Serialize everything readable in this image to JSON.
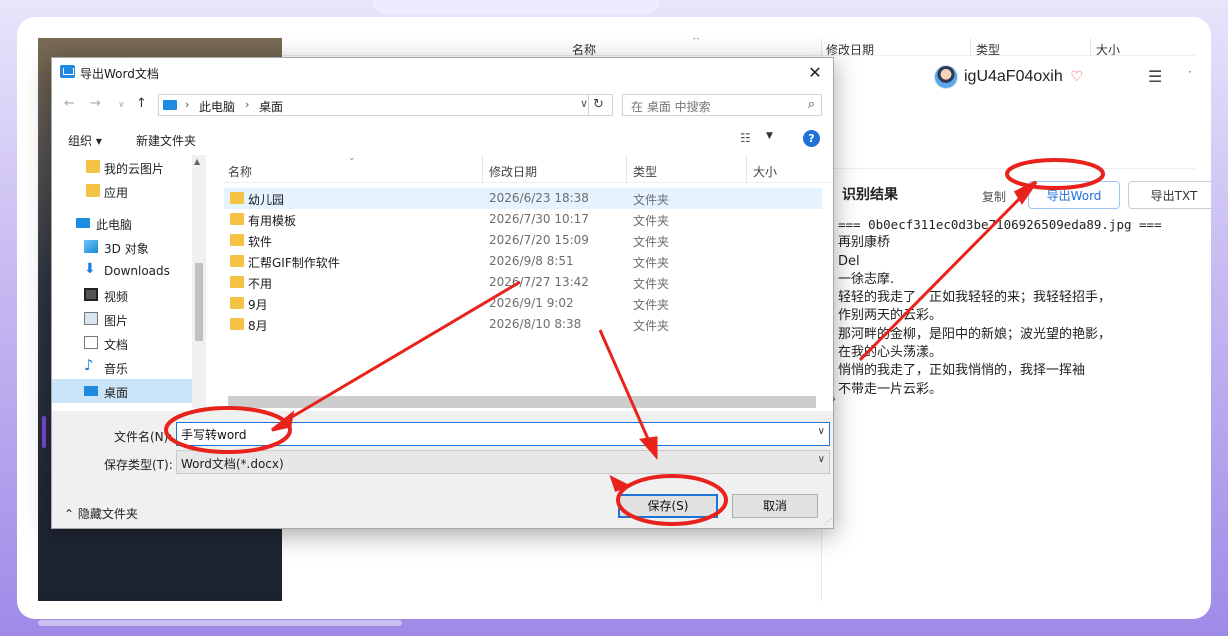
{
  "background_app": {
    "header_cols": [
      "名称",
      "修改日期",
      "类型",
      "大小"
    ],
    "username": "igU4aF04oxih",
    "result_title": "识别结果",
    "copy_label": "复制",
    "export_word_label": "导出Word",
    "export_txt_label": "导出TXT",
    "result_lines": [
      "=== 0b0ecf311ec0d3be7106926509eda89.jpg ===",
      "再别康桥",
      "Del",
      "一徐志摩.",
      "轻轻的我走了，正如我轻轻的来；我轻轻招手，",
      "作别两天的云彩。",
      "那河畔的金柳，是阳中的新娘；波光望的艳影，",
      "在我的心头荡漾。",
      "悄悄的我走了，正如我悄悄的，我择一挥袖",
      "不带走一片云彩。"
    ]
  },
  "dialog": {
    "title": "导出Word文档",
    "close_symbol": "✕",
    "address": {
      "seg1": "此电脑",
      "seg2": "桌面"
    },
    "search_placeholder": "在 桌面 中搜索",
    "organize_label": "组织 ▾",
    "new_folder_label": "新建文件夹",
    "help_symbol": "?",
    "nav_items": [
      {
        "label": "我的云图片",
        "icon": "folder-icon"
      },
      {
        "label": "应用",
        "icon": "folder-icon"
      },
      {
        "label": "此电脑",
        "icon": "pc-icon"
      },
      {
        "label": "3D 对象",
        "icon": "3d-objects-icon"
      },
      {
        "label": "Downloads",
        "icon": "download-icon"
      },
      {
        "label": "视频",
        "icon": "video-icon"
      },
      {
        "label": "图片",
        "icon": "pictures-icon"
      },
      {
        "label": "文档",
        "icon": "documents-icon"
      },
      {
        "label": "音乐",
        "icon": "music-icon"
      },
      {
        "label": "桌面",
        "icon": "desktop-icon"
      }
    ],
    "columns": [
      "名称",
      "修改日期",
      "类型",
      "大小"
    ],
    "files": [
      {
        "name": "幼儿园",
        "date": "2026/6/23 18:38",
        "type": "文件夹"
      },
      {
        "name": "有用模板",
        "date": "2026/7/30 10:17",
        "type": "文件夹"
      },
      {
        "name": "软件",
        "date": "2026/7/20 15:09",
        "type": "文件夹"
      },
      {
        "name": "汇帮GIF制作软件",
        "date": "2026/9/8 8:51",
        "type": "文件夹"
      },
      {
        "name": "不用",
        "date": "2026/7/27 13:42",
        "type": "文件夹"
      },
      {
        "name": "9月",
        "date": "2026/9/1 9:02",
        "type": "文件夹"
      },
      {
        "name": "8月",
        "date": "2026/8/10 8:38",
        "type": "文件夹"
      }
    ],
    "filename_label": "文件名(N):",
    "filename_value": "手写转word",
    "filetype_label": "保存类型(T):",
    "filetype_value": "Word文档(*.docx)",
    "hide_folders_label": "隐藏文件夹",
    "save_label": "保存(S)",
    "cancel_label": "取消"
  },
  "annotation_color": "#e8231c"
}
